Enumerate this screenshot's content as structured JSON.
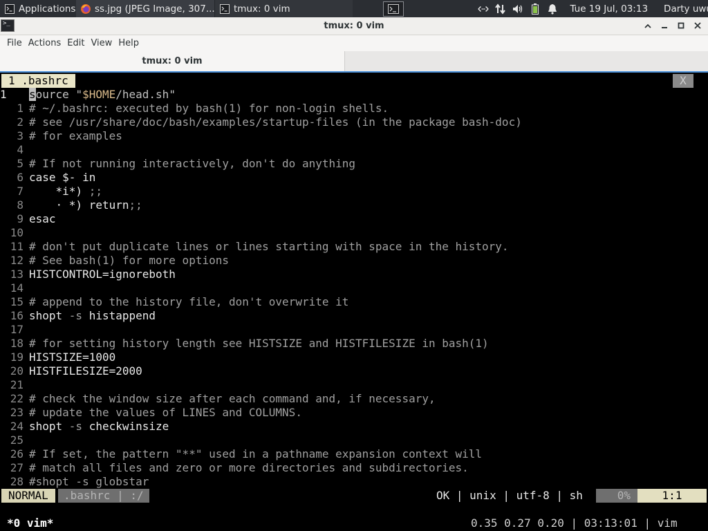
{
  "panel": {
    "applications_label": "Applications",
    "tasks": [
      {
        "label": "ss.jpg (JPEG Image, 307..."
      },
      {
        "label": "tmux: 0 vim"
      }
    ],
    "clock": "Tue 19 Jul, 03:13",
    "user": "Darty uwu",
    "icons": [
      "applications-menu-icon",
      "firefox-icon",
      "terminal-icon",
      "network-icon",
      "transfer-icon",
      "volume-icon",
      "battery-icon",
      "notifications-icon"
    ]
  },
  "window": {
    "title": "tmux: 0 vim"
  },
  "menu": {
    "items": [
      "File",
      "Actions",
      "Edit",
      "View",
      "Help"
    ]
  },
  "tab": {
    "label": "tmux: 0 vim"
  },
  "vim": {
    "tabline": {
      "selected": "1 .bashrc",
      "close": "X"
    },
    "current_line_number": "1",
    "lines": [
      {
        "num": "1",
        "text": "source \"$HOME/head.sh\""
      },
      {
        "num": "1",
        "text": "# ~/.bashrc: executed by bash(1) for non-login shells."
      },
      {
        "num": "2",
        "text": "# see /usr/share/doc/bash/examples/startup-files (in the package bash-doc)"
      },
      {
        "num": "3",
        "text": "# for examples"
      },
      {
        "num": "4",
        "text": ""
      },
      {
        "num": "5",
        "text": "# If not running interactively, don't do anything"
      },
      {
        "num": "6",
        "text": "case $- in"
      },
      {
        "num": "7",
        "text": "    *i*) ;;"
      },
      {
        "num": "8",
        "text": "    · *) return;;"
      },
      {
        "num": "9",
        "text": "esac"
      },
      {
        "num": "10",
        "text": ""
      },
      {
        "num": "11",
        "text": "# don't put duplicate lines or lines starting with space in the history."
      },
      {
        "num": "12",
        "text": "# See bash(1) for more options"
      },
      {
        "num": "13",
        "text": "HISTCONTROL=ignoreboth"
      },
      {
        "num": "14",
        "text": ""
      },
      {
        "num": "15",
        "text": "# append to the history file, don't overwrite it"
      },
      {
        "num": "16",
        "text": "shopt -s histappend"
      },
      {
        "num": "17",
        "text": ""
      },
      {
        "num": "18",
        "text": "# for setting history length see HISTSIZE and HISTFILESIZE in bash(1)"
      },
      {
        "num": "19",
        "text": "HISTSIZE=1000"
      },
      {
        "num": "20",
        "text": "HISTFILESIZE=2000"
      },
      {
        "num": "21",
        "text": ""
      },
      {
        "num": "22",
        "text": "# check the window size after each command and, if necessary,"
      },
      {
        "num": "23",
        "text": "# update the values of LINES and COLUMNS."
      },
      {
        "num": "24",
        "text": "shopt -s checkwinsize"
      },
      {
        "num": "25",
        "text": ""
      },
      {
        "num": "26",
        "text": "# If set, the pattern \"**\" used in a pathname expansion context will"
      },
      {
        "num": "27",
        "text": "# match all files and zero or more directories and subdirectories."
      },
      {
        "num": "28",
        "text": "#shopt -s globstar"
      }
    ],
    "statusline": {
      "mode": "NORMAL",
      "file": ".bashrc | :/",
      "info": "OK | unix | utf-8 | sh",
      "percent": "0%",
      "position": "1:1"
    }
  },
  "tmux": {
    "window": "*0 vim*",
    "status_right": "0.35 0.27 0.20 | 03:13:01 | vim"
  }
}
